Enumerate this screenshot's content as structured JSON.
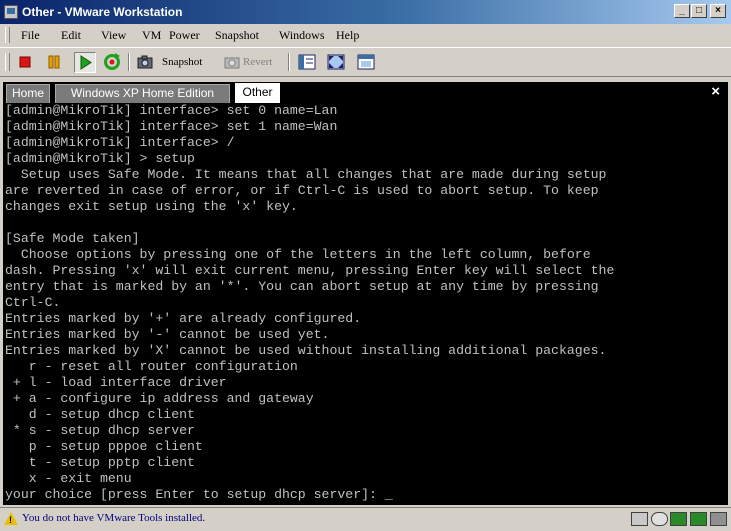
{
  "window": {
    "title": "Other - VMware Workstation",
    "minimize": "_",
    "maximize": "□",
    "close": "×"
  },
  "menu": [
    "File",
    "Edit",
    "View",
    "VM",
    "Power",
    "Snapshot",
    "Windows",
    "Help"
  ],
  "toolbar": {
    "snapshot_label": "Snapshot",
    "revert_label": "Revert"
  },
  "tabs": [
    {
      "label": "Home",
      "active": false
    },
    {
      "label": "Windows XP Home Edition",
      "active": false
    },
    {
      "label": "Other",
      "active": true
    }
  ],
  "tab_close": "×",
  "console": {
    "lines": [
      "[admin@MikroTik] interface> set 0 name=Lan",
      "[admin@MikroTik] interface> set 1 name=Wan",
      "[admin@MikroTik] interface> /",
      "[admin@MikroTik] > setup",
      "  Setup uses Safe Mode. It means that all changes that are made during setup",
      "are reverted in case of error, or if Ctrl-C is used to abort setup. To keep",
      "changes exit setup using the 'x' key.",
      "",
      "[Safe Mode taken]",
      "  Choose options by pressing one of the letters in the left column, before",
      "dash. Pressing 'x' will exit current menu, pressing Enter key will select the",
      "entry that is marked by an '*'. You can abort setup at any time by pressing",
      "Ctrl-C.",
      "Entries marked by '+' are already configured.",
      "Entries marked by '-' cannot be used yet.",
      "Entries marked by 'X' cannot be used without installing additional packages.",
      "   r - reset all router configuration",
      " + l - load interface driver",
      " + a - configure ip address and gateway",
      "   d - setup dhcp client",
      " * s - setup dhcp server",
      "   p - setup pppoe client",
      "   t - setup pptp client",
      "   x - exit menu",
      "your choice [press Enter to setup dhcp server]: _"
    ]
  },
  "status": {
    "message": "You do not have VMware Tools installed."
  },
  "colors": {
    "console_bg": "#000000",
    "console_text": "#c0c0c0",
    "status_text": "#00007a",
    "active_tab_bg": "#ffffff",
    "titlebar": "#0a246a"
  },
  "icons": [
    "vm-icon",
    "stop-icon",
    "pause-icon",
    "play-icon",
    "reset-icon",
    "snapshot-icon",
    "revert-icon",
    "summary-view-icon",
    "fullscreen-icon",
    "quick-switch-icon",
    "warning-icon",
    "hdd-icon",
    "cdrom-icon",
    "network-icon",
    "usb-icon",
    "sound-icon"
  ]
}
